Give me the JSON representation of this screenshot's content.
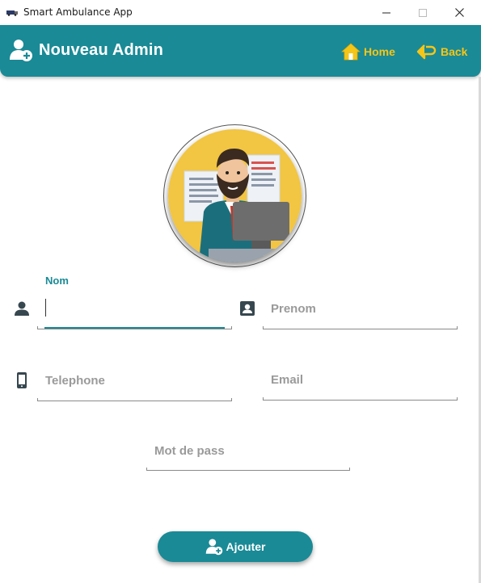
{
  "window": {
    "title": "Smart Ambulance App",
    "controls": [
      "minimize",
      "maximize",
      "close"
    ]
  },
  "header": {
    "title": "Nouveau Admin",
    "icon": "add-user-icon",
    "nav": {
      "home_label": "Home",
      "home_icon": "home-icon",
      "back_label": "Back",
      "back_icon": "back-arrow-icon"
    }
  },
  "form": {
    "nom": {
      "label": "Nom",
      "value": "",
      "icon": "person-icon"
    },
    "prenom": {
      "placeholder": "Prenom",
      "icon": "contact-card-icon"
    },
    "telephone": {
      "placeholder": "Telephone",
      "icon": "phone-icon"
    },
    "email": {
      "placeholder": "Email"
    },
    "password": {
      "placeholder": "Mot de pass"
    }
  },
  "submit": {
    "label": "Ajouter",
    "icon": "add-user-icon"
  },
  "colors": {
    "primary": "#1a8a96",
    "accent": "#f5c518",
    "placeholder": "#9a9a9a"
  }
}
